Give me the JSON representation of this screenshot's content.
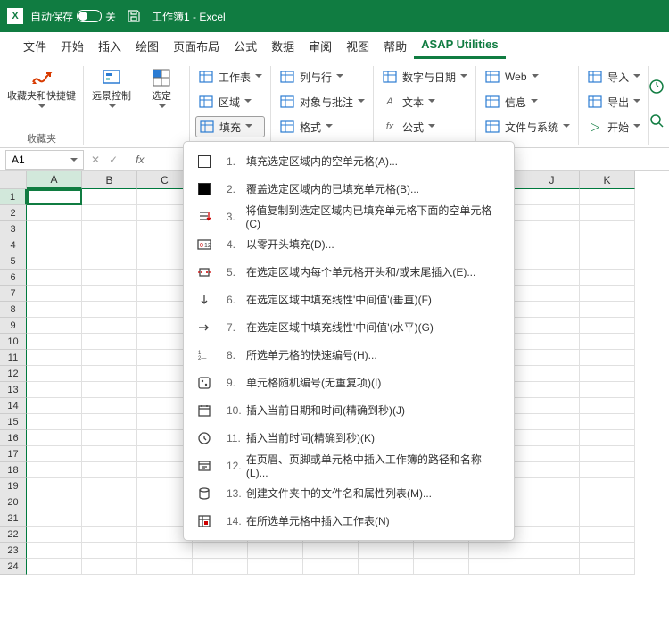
{
  "titlebar": {
    "autosave_label": "自动保存",
    "autosave_state": "关",
    "doc_title": "工作簿1  -  Excel"
  },
  "menu": {
    "tabs": [
      "文件",
      "开始",
      "插入",
      "绘图",
      "页面布局",
      "公式",
      "数据",
      "审阅",
      "视图",
      "帮助",
      "ASAP Utilities"
    ]
  },
  "ribbon": {
    "fav": {
      "label": "收藏夹和快捷键",
      "group_label": "收藏夹"
    },
    "vision": {
      "label": "远景控制"
    },
    "select": {
      "label": "选定"
    },
    "col1": [
      "工作表",
      "区域",
      "填充"
    ],
    "col2": [
      "列与行",
      "对象与批注",
      "格式"
    ],
    "col3": [
      "数字与日期",
      "文本",
      "公式"
    ],
    "col3_prefix": [
      "",
      "A",
      "fx"
    ],
    "col4": [
      "Web",
      "信息",
      "文件与系统"
    ],
    "col5": [
      "导入",
      "导出",
      "开始"
    ]
  },
  "namebox": {
    "value": "A1"
  },
  "columns": [
    "A",
    "B",
    "C",
    "",
    "",
    "",
    "",
    "",
    "",
    "J",
    "K"
  ],
  "rows": [
    "1",
    "2",
    "3",
    "4",
    "5",
    "6",
    "7",
    "8",
    "9",
    "10",
    "11",
    "12",
    "13",
    "14",
    "15",
    "16",
    "17",
    "18",
    "19",
    "20",
    "21",
    "22",
    "23",
    "24"
  ],
  "dropdown": [
    {
      "n": "1.",
      "label": "填充选定区域内的空单元格(A)...",
      "ico": "square-empty"
    },
    {
      "n": "2.",
      "label": "覆盖选定区域内的已填充单元格(B)...",
      "ico": "square-fill"
    },
    {
      "n": "3.",
      "label": "将值复制到选定区域内已填充单元格下面的空单元格(C)",
      "ico": "list-arrow"
    },
    {
      "n": "4.",
      "label": "以零开头填充(D)...",
      "ico": "leading-zero"
    },
    {
      "n": "5.",
      "label": "在选定区域内每个单元格开头和/或末尾插入(E)...",
      "ico": "insert-ends"
    },
    {
      "n": "6.",
      "label": "在选定区域中填充线性'中间值'(垂直)(F)",
      "ico": "arrow-down"
    },
    {
      "n": "7.",
      "label": "在选定区域中填充线性'中间值'(水平)(G)",
      "ico": "arrow-right"
    },
    {
      "n": "8.",
      "label": "所选单元格的快速编号(H)...",
      "ico": "numbers"
    },
    {
      "n": "9.",
      "label": "单元格随机编号(无重复项)(I)",
      "ico": "dice"
    },
    {
      "n": "10.",
      "label": "插入当前日期和时间(精确到秒)(J)",
      "ico": "calendar"
    },
    {
      "n": "11.",
      "label": "插入当前时间(精确到秒)(K)",
      "ico": "clock"
    },
    {
      "n": "12.",
      "label": "在页眉、页脚或单元格中插入工作簿的路径和名称(L)...",
      "ico": "path"
    },
    {
      "n": "13.",
      "label": "创建文件夹中的文件名和属性列表(M)...",
      "ico": "db"
    },
    {
      "n": "14.",
      "label": "在所选单元格中插入工作表(N)",
      "ico": "sheet"
    }
  ]
}
